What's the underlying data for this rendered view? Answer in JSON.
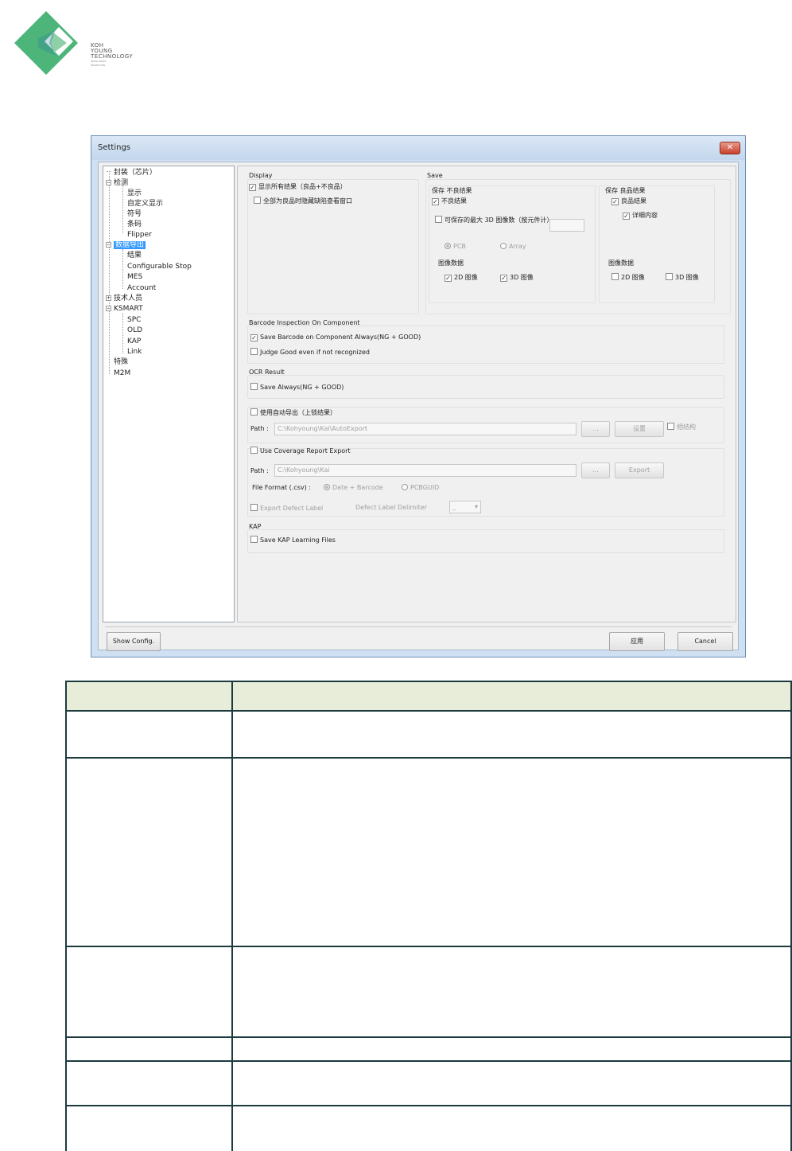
{
  "logo": {
    "line1": "KOH",
    "line2": "YOUNG",
    "line3": "TECHNOLOGY",
    "tagline1": "INTELLIGENT",
    "tagline2": "INSPECTION",
    "colors": {
      "green": "#4db57a",
      "light_green": "#8fd0a8",
      "blue": "#2a6fa8"
    }
  },
  "window": {
    "title": "Settings",
    "close_glyph": "✕"
  },
  "tree": {
    "items": [
      "封装（芯片）",
      "检测",
      "显示",
      "自定义显示",
      "符号",
      "条码",
      "Flipper",
      "数据导出",
      "结果",
      "Configurable Stop",
      "MES",
      "Account",
      "技术人员",
      "KSMART",
      "SPC",
      "OLD",
      "KAP",
      "Link",
      "特殊",
      "M2M"
    ]
  },
  "display": {
    "group_label": "Display",
    "show_all": "显示所有结果（良品+不良品）",
    "show_all_checked": "✓",
    "all_good_popup": "全部为良品时隐藏缺陷查看窗口"
  },
  "save": {
    "group_label": "Save",
    "ng_label": "保存 不良结果",
    "ng_result": "不良结果",
    "max_3d": "可保存的最大 3D 图像数（按元件计）",
    "pcb": "PCB",
    "array": "Array",
    "image_data": "图像数据",
    "img_2d": "2D 图像",
    "img_3d": "3D 图像",
    "good_label": "保存 良品结果",
    "good_result": "良品结果",
    "detail": "详细内容",
    "good_image_data": "图像数据",
    "good_2d": "2D 图像",
    "good_3d": "3D 图像",
    "check": "✓"
  },
  "barcode": {
    "group_label": "Barcode Inspection On Component",
    "save_always": "Save Barcode on Component Always(NG + GOOD)",
    "judge_good": "Judge Good even if not recognized"
  },
  "ocr": {
    "group_label": "OCR Result",
    "save_always": "Save Always(NG + GOOD)"
  },
  "auto_export": {
    "checkbox": "使用自动导出（上锁结果）",
    "path_label": "Path :",
    "path_value": "C:\\Kohyoung\\Kai\\AutoExport",
    "browse": "...",
    "settings": "设置",
    "extra": "相结构"
  },
  "coverage": {
    "checkbox": "Use Coverage Report Export",
    "path_label": "Path :",
    "path_value": "C:\\Kohyoung\\Kai",
    "browse": "...",
    "export": "Export",
    "file_format": "File Format (.csv) :",
    "opt1": "Date + Barcode",
    "opt2": "PCBGUID",
    "export_defect": "Export Defect Label",
    "delimiter_label": "Defect Label Delimiter",
    "delimiter_value": "_"
  },
  "kap": {
    "group_label": "KAP",
    "save_files": "Save KAP Learning Files"
  },
  "buttons": {
    "show_config": "Show Config.",
    "apply": "应用",
    "cancel": "Cancel"
  }
}
